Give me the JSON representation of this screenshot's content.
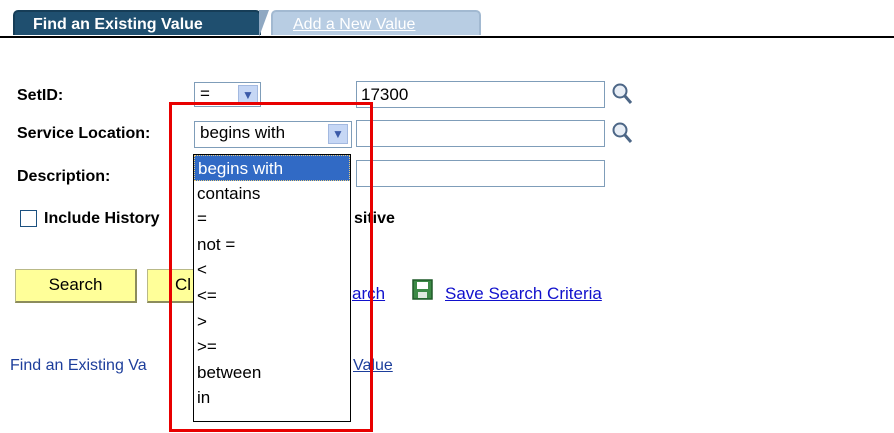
{
  "tabs": {
    "active": "Find an Existing Value",
    "inactive": "Add a New Value"
  },
  "form": {
    "setid": {
      "label": "SetID:",
      "operator": "=",
      "value": "17300"
    },
    "service_location": {
      "label": "Service Location:",
      "operator": "begins with",
      "value": ""
    },
    "description": {
      "label": "Description:",
      "value": ""
    },
    "include_history": {
      "label": "Include History",
      "checked": false
    },
    "case_sensitive_fragment": "sitive"
  },
  "buttons": {
    "search": "Search",
    "clear_fragment": "Cl"
  },
  "links": {
    "basic_search_fragment": "arch",
    "save_search": "Save Search Criteria"
  },
  "footer": {
    "find_fragment": "Find an Existing Va",
    "add_fragment": "Value"
  },
  "dropdown": {
    "options": [
      "begins with",
      "contains",
      "=",
      "not =",
      "<",
      "<=",
      ">",
      ">=",
      "between",
      "in"
    ],
    "selected_index": 0
  },
  "colors": {
    "tab_active_bg": "#1f4f6f",
    "tab_inactive_bg": "#b8cde3",
    "button_bg": "#ffff99",
    "selection_bg": "#316ac5",
    "highlight_box": "#e80000",
    "link": "#1111cc"
  },
  "icons": {
    "lookup": "magnifier-icon",
    "save": "floppy-disk-icon",
    "dropdown": "chevron-down-icon",
    "checkbox": "checkbox-icon"
  }
}
